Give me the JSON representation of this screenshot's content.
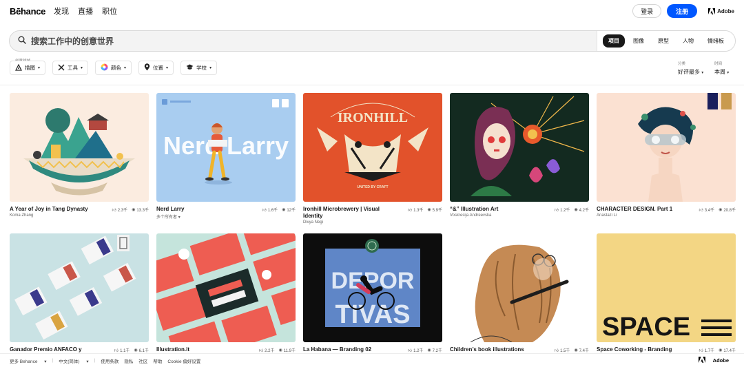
{
  "header": {
    "logo": "Bēhance",
    "nav": [
      "发现",
      "直播",
      "职位"
    ],
    "login": "登录",
    "signup": "注册",
    "adobe": "Adobe"
  },
  "search": {
    "placeholder": "搜索工作中的创意世界",
    "scopes": [
      "项目",
      "图像",
      "原型",
      "人物",
      "情绪板"
    ],
    "active_scope": "项目"
  },
  "filters": {
    "label": "创意领域",
    "items": [
      {
        "label": "插图",
        "icon": "pen-tool-icon"
      },
      {
        "label": "工具",
        "icon": "tools-icon"
      },
      {
        "label": "颜色",
        "icon": "color-wheel-icon"
      },
      {
        "label": "位置",
        "icon": "location-pin-icon"
      },
      {
        "label": "学校",
        "icon": "graduation-cap-icon"
      }
    ],
    "sort": {
      "label": "分类",
      "value": "好评最多"
    },
    "time": {
      "label": "时间",
      "value": "本周"
    }
  },
  "projects": [
    {
      "title": "A Year of Joy in Tang Dynasty",
      "owner": "Koma Zhang",
      "likes": "2.3千",
      "views": "13.3千"
    },
    {
      "title": "Nerd Larry",
      "owner": "多个所有者",
      "likes": "1.6千",
      "views": "12千"
    },
    {
      "title": "Ironhill Microbrewery | Visual Identity",
      "owner": "Divya Negi",
      "likes": "1.3千",
      "views": "5.9千"
    },
    {
      "title": "“&” Illustration Art",
      "owner": "Voskresija Andreevska",
      "likes": "1.2千",
      "views": "4.2千"
    },
    {
      "title": "CHARACTER DESIGN. Part 1",
      "owner": "Anastazi Li",
      "likes": "3.4千",
      "views": "20.8千"
    },
    {
      "title": "Ganador Premio ANFACO y",
      "owner": "",
      "likes": "1.1千",
      "views": "6.1千"
    },
    {
      "title": "Illustration.it",
      "owner": "",
      "likes": "2.2千",
      "views": "11.9千"
    },
    {
      "title": "La Habana — Branding 02",
      "owner": "",
      "likes": "1.2千",
      "views": "7.2千"
    },
    {
      "title": "Children’s book illustrations",
      "owner": "",
      "likes": "1.5千",
      "views": "7.4千"
    },
    {
      "title": "Space Coworking - Branding",
      "owner": "",
      "likes": "1.7千",
      "views": "17.4千"
    }
  ],
  "thumb_text": {
    "nerd": "Nerd Larry",
    "ironhill": "IRONHILL",
    "ironhill_sub": "UNITED BY CRAFT",
    "deportivas": [
      "DEPOR",
      "TIVAS"
    ],
    "space": "SPACE"
  },
  "footer": {
    "links": [
      "更多 Behance",
      "中文(简体)",
      "使用条款",
      "隐私",
      "社区",
      "帮助",
      "Cookie 偏好设置"
    ],
    "adobe": "Adobe"
  },
  "colors": {
    "brand_blue": "#0057ff",
    "text": "#191919",
    "search_bg": "#f3f3f3"
  }
}
